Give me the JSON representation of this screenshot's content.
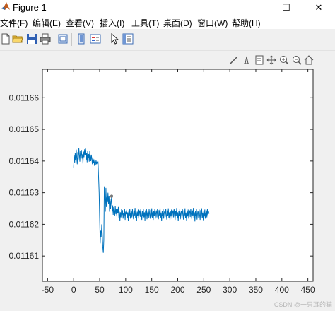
{
  "window": {
    "title": "Figure 1",
    "minimize_glyph": "—",
    "maximize_glyph": "☐",
    "close_glyph": "✕"
  },
  "menu": [
    {
      "label": "文件(F)"
    },
    {
      "label": "编辑(E)"
    },
    {
      "label": "查看(V)"
    },
    {
      "label": "插入(I)"
    },
    {
      "label": "工具(T)"
    },
    {
      "label": "桌面(D)"
    },
    {
      "label": "窗口(W)"
    },
    {
      "label": "帮助(H)"
    }
  ],
  "toolbar_icons": [
    "new-file-icon",
    "open-folder-icon",
    "save-icon",
    "print-icon",
    "print-preview-icon",
    "link-plot-icon",
    "insert-colorbar-icon",
    "insert-legend-icon",
    "edit-plot-arrow-icon",
    "property-inspector-icon"
  ],
  "axes_toolbar_icons": [
    "brush-icon",
    "data-tips-icon",
    "restore-view-icon",
    "pan-icon",
    "zoom-in-icon",
    "zoom-out-icon",
    "home-icon"
  ],
  "watermark": "CSDN @一只耳的猫",
  "colors": {
    "line": "#0072bd",
    "axes_bg": "#ffffff",
    "figure_bg": "#f0f0f0",
    "marker": "#777777"
  },
  "chart_data": {
    "type": "line",
    "title": "",
    "xlabel": "",
    "ylabel": "",
    "xlim": [
      -60,
      460
    ],
    "ylim": [
      0.011602,
      0.011669
    ],
    "xticks": [
      -50,
      0,
      50,
      100,
      150,
      200,
      250,
      300,
      350,
      400,
      450
    ],
    "xtick_labels": [
      "-50",
      "0",
      "50",
      "100",
      "150",
      "200",
      "250",
      "300",
      "350",
      "400",
      "450"
    ],
    "yticks": [
      0.01161,
      0.01162,
      0.01163,
      0.01164,
      0.01165,
      0.01166
    ],
    "ytick_labels": [
      "0.01161",
      "0.01162",
      "0.01163",
      "0.01164",
      "0.01165",
      "0.01166"
    ],
    "grid": false,
    "marker_point": {
      "x": 73,
      "y": 0.0116289
    },
    "series": [
      {
        "x": [
          0,
          1,
          2,
          3,
          4,
          5,
          6,
          7,
          8,
          9,
          10,
          11,
          12,
          13,
          14,
          15,
          16,
          17,
          18,
          19,
          20,
          21,
          22,
          23,
          24,
          25,
          26,
          27,
          28,
          29,
          30,
          31,
          32,
          33,
          34,
          35,
          36,
          37,
          38,
          39,
          40,
          41,
          42,
          43,
          44,
          45,
          46,
          47,
          48,
          49,
          50,
          51,
          52,
          53,
          54,
          55,
          56,
          57,
          58,
          59,
          60,
          61,
          62,
          63,
          64,
          65,
          66,
          67,
          68,
          69,
          70,
          71,
          72,
          73,
          74,
          75,
          76,
          77,
          78,
          79,
          80,
          81,
          82,
          83,
          84,
          85,
          86,
          87,
          88,
          89,
          90,
          91,
          92,
          93,
          94,
          95,
          96,
          97,
          98,
          99,
          100,
          101,
          102,
          103,
          104,
          105,
          106,
          107,
          108,
          109,
          110,
          111,
          112,
          113,
          114,
          115,
          116,
          117,
          118,
          119,
          120,
          121,
          122,
          123,
          124,
          125,
          126,
          127,
          128,
          129,
          130,
          131,
          132,
          133,
          134,
          135,
          136,
          137,
          138,
          139,
          140,
          141,
          142,
          143,
          144,
          145,
          146,
          147,
          148,
          149,
          150,
          151,
          152,
          153,
          154,
          155,
          156,
          157,
          158,
          159,
          160,
          161,
          162,
          163,
          164,
          165,
          166,
          167,
          168,
          169,
          170,
          171,
          172,
          173,
          174,
          175,
          176,
          177,
          178,
          179,
          180,
          181,
          182,
          183,
          184,
          185,
          186,
          187,
          188,
          189,
          190,
          191,
          192,
          193,
          194,
          195,
          196,
          197,
          198,
          199,
          200,
          201,
          202,
          203,
          204,
          205,
          206,
          207,
          208,
          209,
          210,
          211,
          212,
          213,
          214,
          215,
          216,
          217,
          218,
          219,
          220,
          221,
          222,
          223,
          224,
          225,
          226,
          227,
          228,
          229,
          230,
          231,
          232,
          233,
          234,
          235,
          236,
          237,
          238,
          239,
          240,
          241,
          242,
          243,
          244,
          245,
          246,
          247,
          248,
          249,
          250,
          251,
          252,
          253,
          254,
          255,
          256,
          257,
          258,
          259,
          260
        ],
        "y": [
          0.011638,
          0.0116418,
          0.0116395,
          0.0116425,
          0.0116402,
          0.0116436,
          0.011641,
          0.011639,
          0.0116428,
          0.0116405,
          0.011644,
          0.011642,
          0.0116398,
          0.0116432,
          0.0116415,
          0.0116435,
          0.0116408,
          0.0116421,
          0.0116392,
          0.011643,
          0.0116412,
          0.0116437,
          0.0116418,
          0.0116441,
          0.0116402,
          0.0116425,
          0.0116396,
          0.0116433,
          0.011641,
          0.0116422,
          0.0116398,
          0.0116431,
          0.0116415,
          0.01164,
          0.011642,
          0.0116405,
          0.011639,
          0.0116412,
          0.0116395,
          0.0116405,
          0.0116385,
          0.01164,
          0.0116388,
          0.0116402,
          0.011639,
          0.0116398,
          0.0116392,
          0.0116395,
          0.011635,
          0.01163,
          0.011622,
          0.011614,
          0.011618,
          0.011616,
          0.01162,
          0.011617,
          0.011613,
          0.011611,
          0.011615,
          0.011632,
          0.011628,
          0.011624,
          0.0116315,
          0.0116255,
          0.0116285,
          0.011627,
          0.01163,
          0.0116265,
          0.011629,
          0.011624,
          0.011628,
          0.011625,
          0.011627,
          0.0116289,
          0.011624,
          0.011626,
          0.011623,
          0.0116255,
          0.0116245,
          0.0116228,
          0.0116258,
          0.0116232,
          0.011625,
          0.0116225,
          0.0116248,
          0.0116236,
          0.0116255,
          0.011622,
          0.011624,
          0.011621,
          0.0116238,
          0.0116222,
          0.011625,
          0.011623,
          0.0116245,
          0.0116218,
          0.0116236,
          0.0116226,
          0.0116248,
          0.0116214,
          0.011624,
          0.0116232,
          0.0116246,
          0.011622,
          0.0116238,
          0.0116212,
          0.0116244,
          0.0116226,
          0.011625,
          0.0116218,
          0.0116234,
          0.0116242,
          0.0116222,
          0.0116248,
          0.011623,
          0.0116216,
          0.0116244,
          0.0116228,
          0.0116252,
          0.011622,
          0.0116236,
          0.011621,
          0.011624,
          0.0116226,
          0.0116247,
          0.0116218,
          0.0116234,
          0.0116244,
          0.0116224,
          0.011625,
          0.011623,
          0.0116214,
          0.0116242,
          0.0116226,
          0.0116248,
          0.0116222,
          0.0116238,
          0.0116212,
          0.0116244,
          0.0116228,
          0.011625,
          0.0116216,
          0.0116236,
          0.0116242,
          0.011622,
          0.0116248,
          0.0116232,
          0.0116218,
          0.0116246,
          0.0116224,
          0.0116251,
          0.011622,
          0.0116238,
          0.0116214,
          0.0116243,
          0.0116226,
          0.0116249,
          0.0116218,
          0.0116236,
          0.0116244,
          0.0116222,
          0.011625,
          0.011623,
          0.0116216,
          0.0116245,
          0.0116228,
          0.0116252,
          0.0116221,
          0.0116237,
          0.0116211,
          0.0116242,
          0.0116227,
          0.0116248,
          0.0116218,
          0.0116235,
          0.0116243,
          0.0116223,
          0.0116249,
          0.0116231,
          0.0116215,
          0.0116244,
          0.0116226,
          0.0116251,
          0.0116219,
          0.0116238,
          0.0116213,
          0.0116241,
          0.0116225,
          0.0116247,
          0.0116217,
          0.0116236,
          0.0116244,
          0.0116222,
          0.011625,
          0.0116229,
          0.0116214,
          0.0116243,
          0.0116227,
          0.0116252,
          0.011622,
          0.0116238,
          0.011621,
          0.0116242,
          0.0116226,
          0.0116248,
          0.0116216,
          0.0116235,
          0.0116243,
          0.0116221,
          0.0116249,
          0.011623,
          0.0116215,
          0.0116245,
          0.0116228,
          0.0116251,
          0.0116219,
          0.0116237,
          0.0116212,
          0.0116241,
          0.0116225,
          0.0116247,
          0.0116218,
          0.0116236,
          0.0116244,
          0.0116223,
          0.011625,
          0.0116231,
          0.0116216,
          0.0116244,
          0.0116227,
          0.0116252,
          0.011622,
          0.0116238,
          0.0116209,
          0.0116242,
          0.0116226,
          0.0116248,
          0.0116215,
          0.0116235,
          0.0116243,
          0.0116221,
          0.0116249,
          0.011623,
          0.0116214,
          0.0116245,
          0.0116228,
          0.0116251,
          0.0116219,
          0.0116237,
          0.0116213,
          0.0116241,
          0.0116225,
          0.0116247,
          0.0116218,
          0.0116236,
          0.0116244,
          0.0116222,
          0.011625,
          0.0116229,
          0.0116242,
          0.0116233
        ]
      }
    ]
  }
}
